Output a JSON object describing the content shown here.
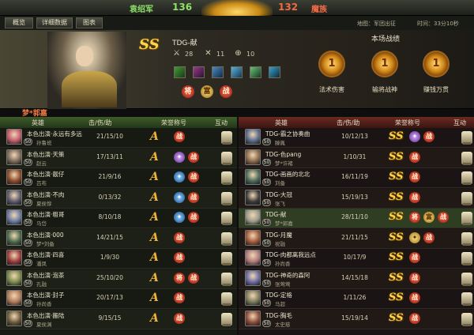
{
  "topbar": {
    "left_faction": "袁绍军",
    "left_score": "136",
    "right_score": "132",
    "right_faction": "魔族"
  },
  "tabs": [
    "概览",
    "详细数据",
    "图表"
  ],
  "map": {
    "label": "地图：军团出征"
  },
  "time": {
    "label": "时间：33分10秒"
  },
  "hero": {
    "rank": "SS",
    "name": "TDG-献",
    "stats": [
      "28",
      "11",
      "10"
    ],
    "team_player": "梦*郭嘉"
  },
  "battle": {
    "title": "本场战绩",
    "medal_labels": [
      "法术伤害",
      "输将战神",
      "赚钱万贯"
    ],
    "medal_glyph": "1"
  },
  "headers": {
    "left": [
      "英雄",
      "击/伤/助",
      "荣誉称号",
      "互动"
    ],
    "right": [
      "英雄",
      "击/伤/助",
      "荣誉称号",
      "互动"
    ]
  },
  "left_rows": [
    {
      "name": "本色出演·永远有多远",
      "sub": "孙鲁班",
      "lv": "50",
      "kda": "21/15/10",
      "color": "#c25a6a"
    },
    {
      "name": "本色出演·天策",
      "sub": "赵云",
      "lv": "50",
      "kda": "17/13/11",
      "color": "#7a6a5a"
    },
    {
      "name": "本色出演·靓仔",
      "sub": "吕布",
      "lv": "50",
      "kda": "21/9/16",
      "color": "#8a4a2a"
    },
    {
      "name": "本色出演·不肉",
      "sub": "夏侯惇",
      "lv": "50",
      "kda": "0/13/32",
      "color": "#5a5a6a"
    },
    {
      "name": "本色出演·粗哥",
      "sub": "马岱",
      "lv": "50",
      "kda": "8/10/18",
      "color": "#6a7aa0"
    },
    {
      "name": "本色出演·000",
      "sub": "梦*刘备",
      "lv": "50",
      "kda": "14/21/15",
      "color": "#4a6a4a"
    },
    {
      "name": "本色出演·四喜",
      "sub": "潘凤",
      "lv": "50",
      "kda": "1/9/30",
      "color": "#9a3a3a"
    },
    {
      "name": "本色出演·泡茶",
      "sub": "孔融",
      "lv": "50",
      "kda": "25/10/20",
      "color": "#7a8a4a"
    },
    {
      "name": "本色出演·封子",
      "sub": "孙尚香",
      "lv": "50",
      "kda": "20/17/13",
      "color": "#b07a5a"
    },
    {
      "name": "本色出演·搬陆",
      "sub": "夏侯渊",
      "lv": "50",
      "kda": "9/15/15",
      "color": "#6a5a3a"
    }
  ],
  "right_rows": [
    {
      "name": "TDG-霸之协奏曲",
      "sub": "滕胤",
      "lv": "50",
      "kda": "10/12/13",
      "color": "#5a6a8a"
    },
    {
      "name": "TDG-色pang",
      "sub": "梦*许褚",
      "lv": "50",
      "kda": "1/10/31",
      "color": "#8a6a4a"
    },
    {
      "name": "TDG-画画的北北",
      "sub": "刘备",
      "lv": "50",
      "kda": "16/11/19",
      "color": "#4a6a5a"
    },
    {
      "name": "TDG-大冠",
      "sub": "张飞",
      "lv": "50",
      "kda": "15/19/13",
      "color": "#3a3a3a"
    },
    {
      "name": "TDG-献",
      "sub": "梦*郭嘉",
      "lv": "50",
      "kda": "28/11/10",
      "color": "#9a9a8a"
    },
    {
      "name": "TDG-月魔",
      "sub": "祝融",
      "lv": "50",
      "kda": "21/11/15",
      "color": "#a05a3a"
    },
    {
      "name": "TDG-肉都离我远点",
      "sub": "孙尚香",
      "lv": "50",
      "kda": "10/17/9",
      "color": "#b07a7a"
    },
    {
      "name": "TDG-神奇的森阿",
      "sub": "张莺莺",
      "lv": "50",
      "kda": "14/15/18",
      "color": "#6a6aa0"
    },
    {
      "name": "TDG-定格",
      "sub": "马超",
      "lv": "50",
      "kda": "1/11/26",
      "color": "#7a7a5a"
    },
    {
      "name": "TDG-胸毛",
      "sub": "太史慈",
      "lv": "50",
      "kda": "15/19/14",
      "color": "#8a4a3a"
    }
  ],
  "left_honors": [
    [
      [
        "A",
        "a"
      ],
      [
        "战",
        "red"
      ]
    ],
    [
      [
        "A",
        "a"
      ],
      [
        "✦",
        "purple"
      ],
      [
        "战",
        "red"
      ]
    ],
    [
      [
        "A",
        "a"
      ],
      [
        "✦",
        "blue"
      ],
      [
        "战",
        "red"
      ]
    ],
    [
      [
        "A",
        "a"
      ],
      [
        "✦",
        "blue"
      ],
      [
        "战",
        "red"
      ]
    ],
    [
      [
        "A",
        "a"
      ],
      [
        "✦",
        "blue"
      ],
      [
        "战",
        "red"
      ]
    ],
    [
      [
        "A",
        "a"
      ],
      [
        "战",
        "red"
      ]
    ],
    [
      [
        "A",
        "a"
      ],
      [
        "战",
        "red"
      ]
    ],
    [
      [
        "A",
        "a"
      ],
      [
        "将",
        "red"
      ],
      [
        "战",
        "red"
      ]
    ],
    [
      [
        "A",
        "a"
      ],
      [
        "战",
        "red"
      ]
    ],
    [
      [
        "A",
        "a"
      ],
      [
        "战",
        "red"
      ]
    ]
  ],
  "right_honors": [
    [
      [
        "SS",
        "ss"
      ],
      [
        "✦",
        "purple"
      ],
      [
        "战",
        "red"
      ]
    ],
    [
      [
        "SS",
        "ss"
      ],
      [
        "战",
        "red"
      ]
    ],
    [
      [
        "SS",
        "ss"
      ],
      [
        "战",
        "red"
      ]
    ],
    [
      [
        "SS",
        "ss"
      ],
      [
        "战",
        "red"
      ]
    ],
    [
      [
        "SS",
        "ss"
      ],
      [
        "将",
        "red"
      ],
      [
        "富",
        "gold"
      ],
      [
        "战",
        "red"
      ]
    ],
    [
      [
        "SS",
        "ss"
      ],
      [
        "✦",
        "gold"
      ],
      [
        "战",
        "red"
      ]
    ],
    [
      [
        "SS",
        "ss"
      ],
      [
        "战",
        "red"
      ]
    ],
    [
      [
        "SS",
        "ss"
      ],
      [
        "战",
        "red"
      ]
    ],
    [
      [
        "SS",
        "ss"
      ],
      [
        "战",
        "red"
      ]
    ],
    [
      [
        "SS",
        "ss"
      ],
      [
        "战",
        "red"
      ]
    ]
  ],
  "colors": {
    "green": "#8ee06a",
    "red": "#f06a45",
    "gold": "#ffd44a"
  }
}
